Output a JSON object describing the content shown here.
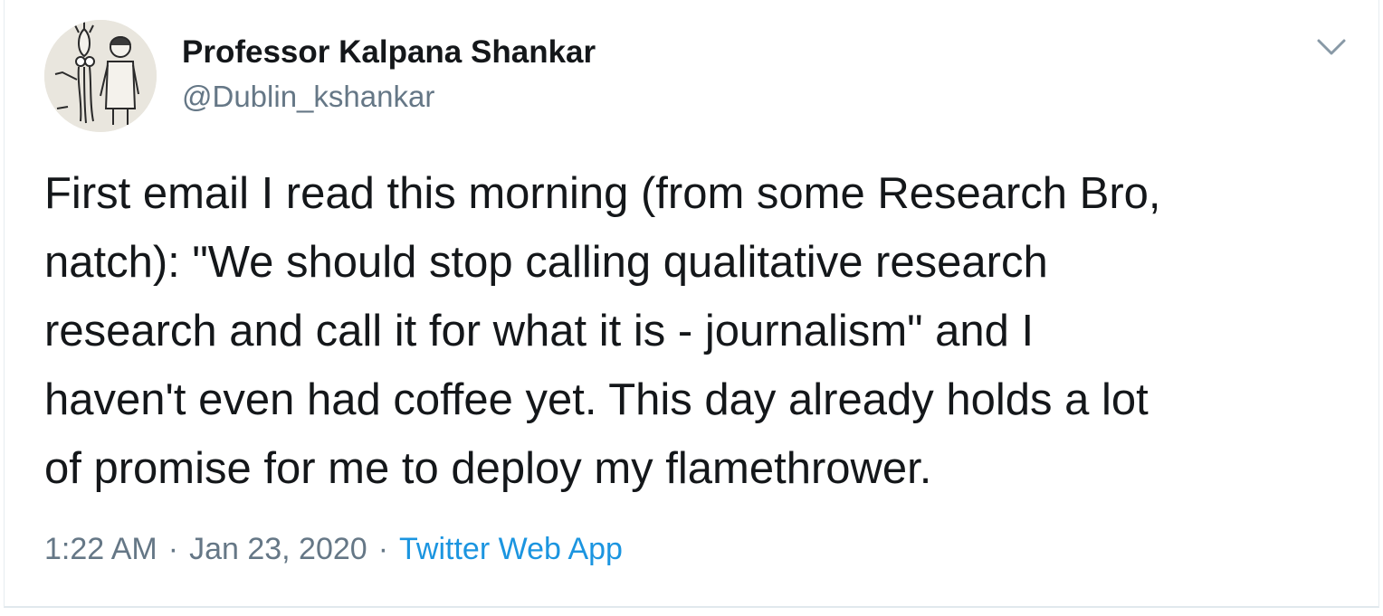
{
  "author": {
    "display_name": "Professor Kalpana Shankar",
    "handle": "@Dublin_kshankar",
    "avatar_icon": "cartoon-avatar-illustration"
  },
  "menu": {
    "icon": "chevron-down-icon"
  },
  "tweet": {
    "text": "First email I read  this morning (from some Research Bro,\nnatch): \"We should stop calling qualitative research\nresearch and call it for what it is - journalism\" and I\nhaven't even had coffee yet. This day already holds a lot\nof promise  for me to deploy my flamethrower."
  },
  "meta": {
    "time": "1:22 AM",
    "separator": "·",
    "date": "Jan 23, 2020",
    "source": "Twitter Web App"
  },
  "colors": {
    "text": "#14171a",
    "secondary": "#657786",
    "link": "#1b95e0",
    "border": "#e1e8ed"
  }
}
